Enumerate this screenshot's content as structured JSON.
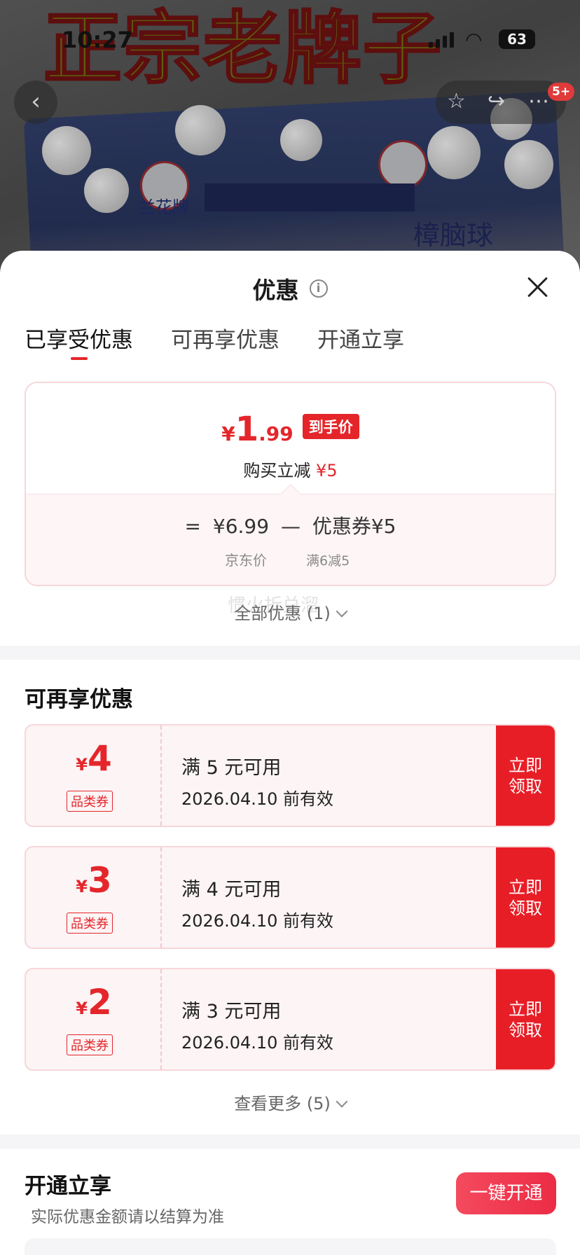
{
  "status_bar": {
    "time": "10:27",
    "battery": "63"
  },
  "background": {
    "headline": "正宗老牌子",
    "brand_small": "兰花牌",
    "product_text": "樟脑球",
    "cart_badge": "5+"
  },
  "sheet": {
    "title": "优惠",
    "tabs": [
      "已享受优惠",
      "可再享优惠",
      "开通立享"
    ],
    "summary": {
      "currency": "¥",
      "price_int": "1",
      "price_dec": ".99",
      "price_tag": "到手价",
      "buy_text": "购买立减",
      "buy_amount": "¥5",
      "formula_eq": "=",
      "formula_price": "¥6.99",
      "formula_minus": "—",
      "formula_coupon": "优惠券¥5",
      "price_label": "京东价",
      "coupon_rule": "满6减5"
    },
    "all_offers": "全部优惠 (1)",
    "watermark": "惯火折兑溜",
    "more_section": {
      "title": "可再享优惠",
      "coupons": [
        {
          "amount": "4",
          "type": "品类券",
          "condition": "满 5 元可用",
          "expiry": "2026.04.10 前有效",
          "button": "立即领取"
        },
        {
          "amount": "3",
          "type": "品类券",
          "condition": "满 4 元可用",
          "expiry": "2026.04.10 前有效",
          "button": "立即领取"
        },
        {
          "amount": "2",
          "type": "品类券",
          "condition": "满 3 元可用",
          "expiry": "2026.04.10 前有效",
          "button": "立即领取"
        }
      ],
      "see_more": "查看更多 (5)"
    },
    "subscribe": {
      "title": "开通立享",
      "subtitle": "实际优惠金额请以结算为准",
      "button": "一键开通"
    }
  },
  "colors": {
    "accent": "#e4262b",
    "button": "#e81e27"
  }
}
